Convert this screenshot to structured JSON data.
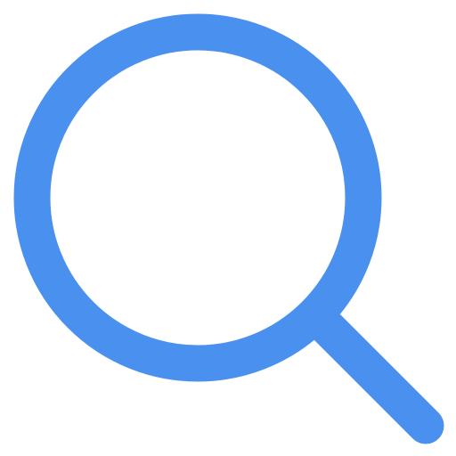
{
  "icon": {
    "name": "search-icon",
    "color": "#4A90EE",
    "background": "#FFFFFF"
  }
}
